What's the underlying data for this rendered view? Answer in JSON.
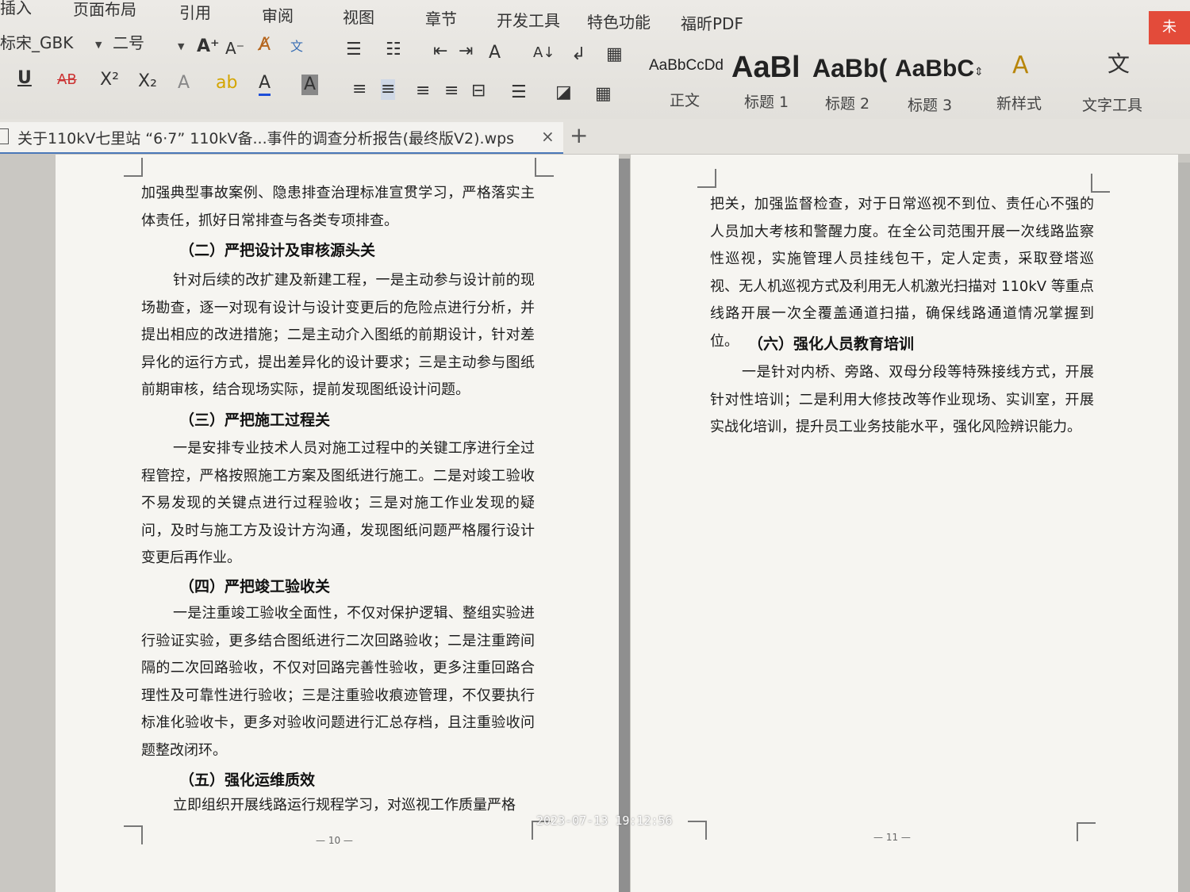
{
  "ribbon": {
    "tabs": [
      "插入",
      "页面布局",
      "引用",
      "审阅",
      "视图",
      "章节",
      "开发工具",
      "特色功能",
      "福昕PDF"
    ],
    "font_name": "标宋_GBK",
    "font_size": "二号",
    "styles": [
      {
        "sample": "AaBbCcDd",
        "label": "正文"
      },
      {
        "sample": "AaBl",
        "label": "标题 1"
      },
      {
        "sample": "AaBb(",
        "label": "标题 2"
      },
      {
        "sample": "AaBbC",
        "label": "标题 3"
      }
    ],
    "new_style_label": "新样式",
    "text_tools_label": "文字工具",
    "close_glyph": "未"
  },
  "doc_tab": {
    "title": "关于110kV七里站 “6·7” 110kV备...事件的调查分析报告(最终版V2).wps",
    "close": "×",
    "new": "+"
  },
  "left_page": {
    "blocks": [
      {
        "type": "p",
        "text": "加强典型事故案例、隐患排查治理标准宣贯学习，严格落实主体责任，抓好日常排查与各类专项排查。"
      },
      {
        "type": "h",
        "text": "（二）严把设计及审核源头关"
      },
      {
        "type": "p",
        "text": "针对后续的改扩建及新建工程，一是主动参与设计前的现场勘查，逐一对现有设计与设计变更后的危险点进行分析，并提出相应的改进措施；二是主动介入图纸的前期设计，针对差异化的运行方式，提出差异化的设计要求；三是主动参与图纸前期审核，结合现场实际，提前发现图纸设计问题。"
      },
      {
        "type": "h",
        "text": "（三）严把施工过程关"
      },
      {
        "type": "p",
        "text": "一是安排专业技术人员对施工过程中的关键工序进行全过程管控，严格按照施工方案及图纸进行施工。二是对竣工验收不易发现的关键点进行过程验收；三是对施工作业发现的疑问，及时与施工方及设计方沟通，发现图纸问题严格履行设计变更后再作业。"
      },
      {
        "type": "h",
        "text": "（四）严把竣工验收关"
      },
      {
        "type": "p",
        "text": "一是注重竣工验收全面性，不仅对保护逻辑、整组实验进行验证实验，更多结合图纸进行二次回路验收；二是注重跨间隔的二次回路验收，不仅对回路完善性验收，更多注重回路合理性及可靠性进行验收；三是注重验收痕迹管理，不仅要执行标准化验收卡，更多对验收问题进行汇总存档，且注重验收问题整改闭环。"
      },
      {
        "type": "h",
        "text": "（五）强化运维质效"
      },
      {
        "type": "p",
        "text": "立即组织开展线路运行规程学习，对巡视工作质量严格"
      }
    ],
    "page_number": "— 10 —"
  },
  "right_page": {
    "blocks": [
      {
        "type": "p",
        "text": "把关，加强监督检查，对于日常巡视不到位、责任心不强的人员加大考核和警醒力度。在全公司范围开展一次线路监察性巡视，实施管理人员挂线包干，定人定责，采取登塔巡视、无人机巡视方式及利用无人机激光扫描对 110kV 等重点线路开展一次全覆盖通道扫描，确保线路通道情况掌握到位。"
      },
      {
        "type": "h",
        "text": "（六）强化人员教育培训"
      },
      {
        "type": "p",
        "text": "一是针对内桥、旁路、双母分段等特殊接线方式，开展针对性培训；二是利用大修技改等作业现场、实训室，开展实战化培训，提升员工业务技能水平，强化风险辨识能力。"
      }
    ],
    "page_number": "— 11 —"
  },
  "photo_timestamp": "2023-07-13 19:12:56"
}
